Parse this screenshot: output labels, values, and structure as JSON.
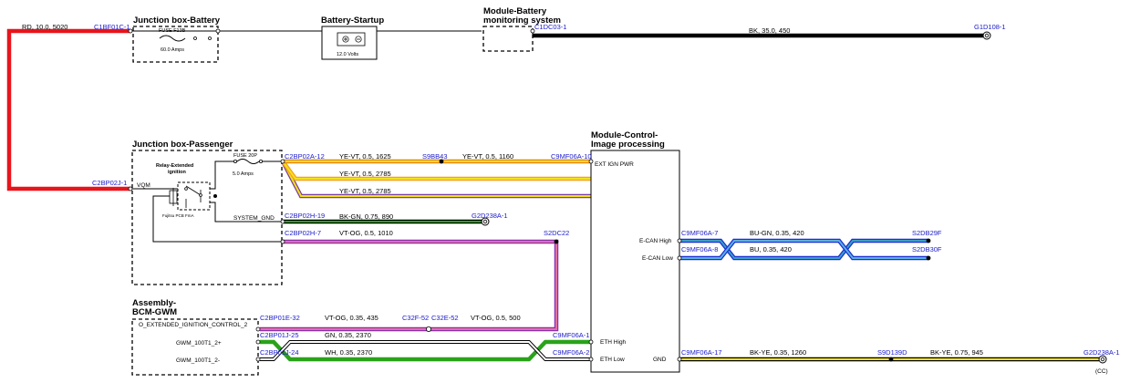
{
  "boxes": {
    "junction_battery": "Junction box-Battery",
    "battery_startup": "Battery-Startup",
    "bms_line1": "Module-Battery",
    "bms_line2": "monitoring system",
    "junction_passenger": "Junction box-Passenger",
    "image_proc_line1": "Module-Control-",
    "image_proc_line2": "Image processing",
    "bcm_line1": "Assembly-",
    "bcm_line2": "BCM-GWM"
  },
  "components": {
    "fuse_f13b": "FUSE F13B",
    "fuse_f13b_rating": "60.0 Amps",
    "battery_voltage": "12.0 Volts",
    "relay_title_line1": "Relay-Extended",
    "relay_title_line2": "ignition",
    "relay_part": "Fujitsu PCB FmA",
    "fuse_20p": "FUSE 20P",
    "fuse_20p_rating": "5.0 Amps",
    "vqm_label": "VQM",
    "system_gnd": "SYSTEM_GND"
  },
  "connectors": {
    "c1bf01c": "C1BF01C-1",
    "c1dc03": "C1DC03-1",
    "g1d108": "G1D108-1",
    "c2bp02j": "C2BP02J-1",
    "c2bp02a": "C2BP02A-12",
    "s9bb43": "S9BB43",
    "c9mf06a_10": "C9MF06A-10",
    "c2bp02h_19": "C2BP02H-19",
    "g2d238a_top": "G2D238A-1",
    "c2bp02h_7": "C2BP02H-7",
    "s2dc22": "S2DC22",
    "c9mf06a_7": "C9MF06A-7",
    "s2db29f": "S2DB29F",
    "c9mf06a_8": "C9MF06A-8",
    "s2db30f": "S2DB30F",
    "c2bp01e_32": "C2BP01E-32",
    "c32f_52": "C32F-52",
    "c32e_52": "C32E-52",
    "c9mf06a_1": "C9MF06A-1",
    "c2bp01j_25": "C2BP01J-25",
    "c9mf06a_2": "C9MF06A-2",
    "c2bp01j_24": "C2BP01J-24",
    "c9mf06a_17": "C9MF06A-17",
    "s9d139d": "S9D139D",
    "g2d238a_bottom": "G2D238A-1"
  },
  "wires": {
    "rd_top": "RD, 10.0, 5020",
    "bk_top": "BK, 35.0, 450",
    "yevt_1": "YE-VT, 0.5, 1625",
    "yevt_2": "YE-VT, 0.5, 1160",
    "yevt_3": "YE-VT, 0.5, 2785",
    "yevt_4": "YE-VT, 0.5, 2785",
    "bkgn": "BK-GN, 0.75, 890",
    "vtog_1": "VT-OG, 0.5, 1010",
    "bugn": "BU-GN, 0.35, 420",
    "bu": "BU, 0.35, 420",
    "vtog_2": "VT-OG, 0.35, 435",
    "vtog_3": "VT-OG, 0.5, 500",
    "gn": "GN, 0.35, 2370",
    "wh": "WH, 0.35, 2370",
    "bkye_1": "BK-YE, 0.35, 1260",
    "bkye_2": "BK-YE, 0.75, 945"
  },
  "pins": {
    "ext_ign_pwr": "EXT IGN PWR",
    "ecan_high": "E-CAN High",
    "ecan_low": "E-CAN Low",
    "eth_high": "ETH High",
    "eth_low": "ETH Low",
    "gnd": "GND",
    "o_ext_ign": "O_EXTENDED_IGNITION_CONTROL_2",
    "gwm_2p": "GWM_100T1_2+",
    "gwm_2m": "GWM_100T1_2-",
    "cc": "(CC)"
  },
  "colors": {
    "red": "#e8141c",
    "black": "#000000",
    "yellow": "#f2e21a",
    "violet": "#8b2fb0",
    "green": "#2aa21a",
    "blue": "#1a2fd0",
    "orange": "#f5a020",
    "pink": "#e07090"
  }
}
